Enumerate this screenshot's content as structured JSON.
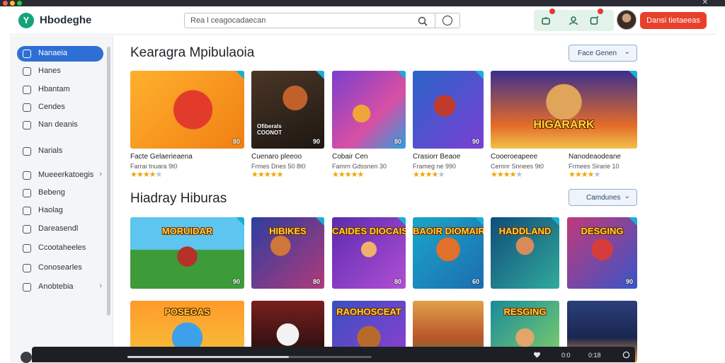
{
  "header": {
    "brand": "Hbodeghe",
    "logo_letter": "Y",
    "search_placeholder": "Rea l ceagocadaecan",
    "cta_label": "Dansi tietaeeas",
    "notification_count_a": "3",
    "notification_count_b": "9"
  },
  "sidebar": {
    "items": [
      {
        "label": "Nanaeia",
        "icon": "home-icon",
        "active": true
      },
      {
        "label": "Hanes",
        "icon": "heart-icon"
      },
      {
        "label": "Hbantam",
        "icon": "book-icon"
      },
      {
        "label": "Cendes",
        "icon": "chat-icon"
      },
      {
        "label": "Nan deanis",
        "icon": "user-icon"
      },
      {
        "label": "Narials",
        "icon": "clock-icon"
      },
      {
        "label": "Mueeerkatoegis",
        "icon": "folder-icon",
        "has_children": true
      },
      {
        "label": "Bebeng",
        "icon": "grid-icon"
      },
      {
        "label": "Haolag",
        "icon": "calendar-icon"
      },
      {
        "label": "Dareasendl",
        "icon": "document-icon"
      },
      {
        "label": "Ccootaheeles",
        "icon": "collection-icon"
      },
      {
        "label": "Conosearles",
        "icon": "globe-icon"
      },
      {
        "label": "Anobtebia",
        "icon": "settings-icon",
        "has_children": true
      }
    ]
  },
  "sections": [
    {
      "title": "Kearagra Mpibulaoia",
      "button_label": "Face Genen",
      "cards": [
        {
          "title": "Facte Gelaerieaena",
          "sub": "Farrai tnuara 9t0",
          "badge": "80",
          "art": "red-creature",
          "stars": 4
        },
        {
          "title": "Cuenaro pleeoo",
          "sub": "Frmes Dnes 50 8t0",
          "badge": "90",
          "art": "retro-console",
          "stars": 5,
          "overlay": "Ofiberals\nCOONOT"
        },
        {
          "title": "Cobair Cen",
          "sub": "Famrn Gdssnen 30",
          "badge": "80",
          "art": "game-cubes",
          "stars": 5
        },
        {
          "title": "Crasiorr Beaoe",
          "sub": "Frameg ne 990",
          "badge": "90",
          "art": "fighter",
          "stars": 4
        },
        {
          "title": "Cooeroeapeee",
          "sub": "Cemnr Snnees 9t0",
          "badge": "",
          "art": "heroes",
          "stars": 4,
          "banner": "HIGARARK"
        },
        {
          "title": "Nanodeaodeane",
          "sub": "Frmees Sirarie 10",
          "badge": "70",
          "art": "heroes-b",
          "stars": 4
        }
      ]
    },
    {
      "title": "Hiadray Hiburas",
      "button_label": "Camdunes",
      "cards": [
        {
          "banner": "MORUIDAR",
          "badge": "90",
          "art": "field"
        },
        {
          "banner": "HIBIKES",
          "badge": "80",
          "art": "crowd"
        },
        {
          "banner": "CAIDES DIOCAIS",
          "badge": "80",
          "art": "purple-crew"
        },
        {
          "banner": "BAOIR DIOMAIR",
          "badge": "60",
          "art": "orange-hero"
        },
        {
          "banner": "HADDLAND",
          "badge": "",
          "art": "cyber-hero"
        },
        {
          "banner": "DESGING",
          "badge": "90",
          "art": "red-hero"
        }
      ]
    },
    {
      "title": "",
      "cards": [
        {
          "banner": "POSEGAS",
          "art": "blue-pals"
        },
        {
          "banner": "",
          "art": "white-fox"
        },
        {
          "banner": "RAOHOSCEAT",
          "art": "brown-bear"
        },
        {
          "banner": "",
          "art": "town"
        },
        {
          "banner": "RESGING",
          "art": "kids"
        },
        {
          "banner": "",
          "art": "city-night"
        }
      ]
    }
  ],
  "player": {
    "progress": 0.66,
    "time_a": "0:0",
    "time_b": "0:18"
  },
  "colors": {
    "accent": "#2e6fd4",
    "cta": "#e8402a",
    "star": "#f0a500",
    "star_off": "#aac4e6"
  }
}
